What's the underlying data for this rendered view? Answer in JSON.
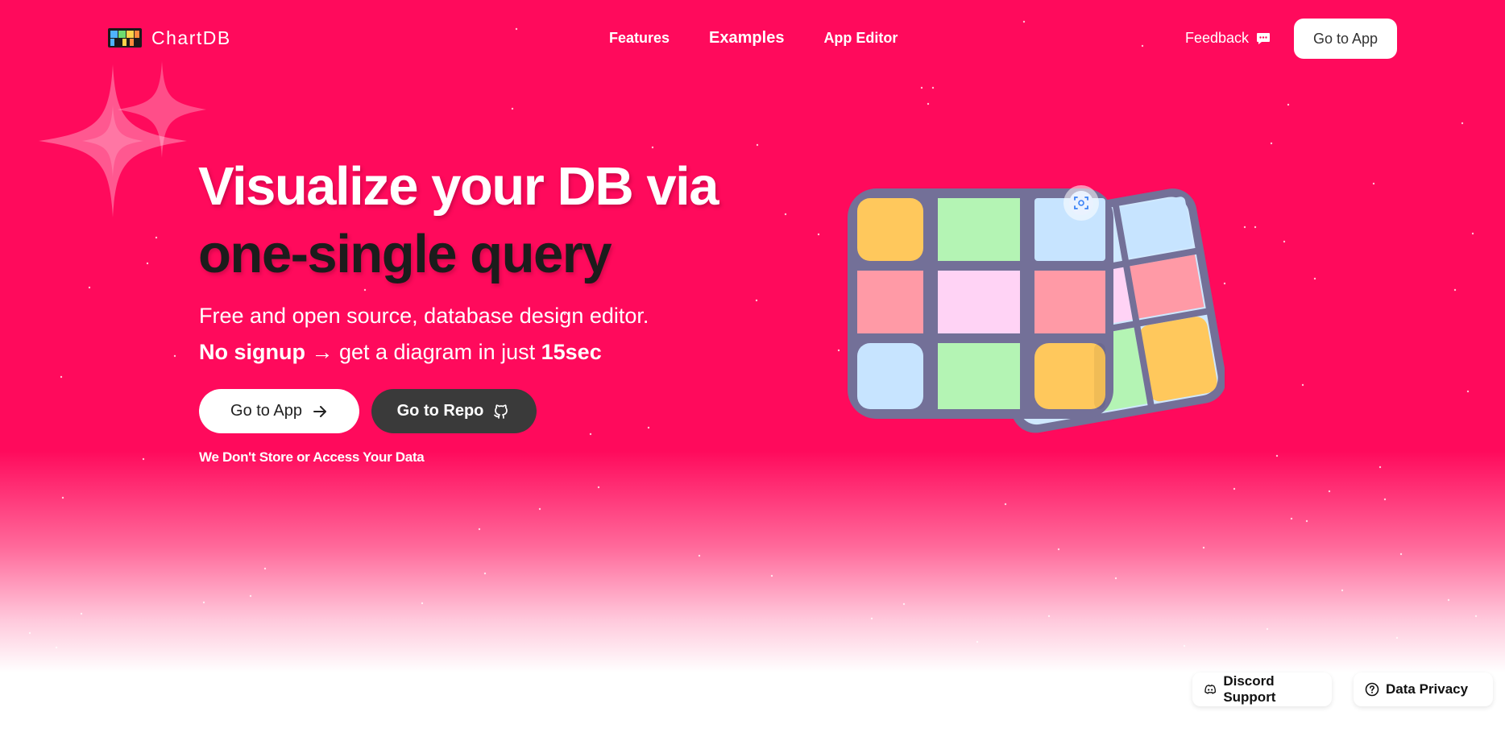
{
  "brand": {
    "name": "ChartDB"
  },
  "nav": {
    "features": "Features",
    "examples": "Examples",
    "app_editor": "App Editor"
  },
  "header": {
    "feedback_label": "Feedback",
    "go_to_app": "Go to App"
  },
  "hero": {
    "headline_line1": "Visualize your DB via",
    "headline_line2": "one-single query",
    "subtitle_line1": "Free and open source, database design editor.",
    "subtitle_bold1": "No signup",
    "subtitle_mid": " → get a diagram in just ",
    "subtitle_bold2": "15sec",
    "cta_app": "Go to App",
    "cta_repo": "Go to Repo",
    "privacy_note": "We Don't Store or Access Your Data"
  },
  "footer_pills": {
    "discord": "Discord Support",
    "data_privacy": "Data Privacy"
  },
  "icons": {
    "feedback": "speech-bubble-icon",
    "arrow": "arrow-right-icon",
    "repo": "github-icon",
    "discord": "discord-icon",
    "privacy": "question-circle-icon",
    "focus": "focus-scan-icon"
  },
  "colors": {
    "brand_pink": "#ff0a5c",
    "white": "#ffffff",
    "dark_button": "#3a3a3a",
    "headline_dark": "#1c1c1c"
  }
}
